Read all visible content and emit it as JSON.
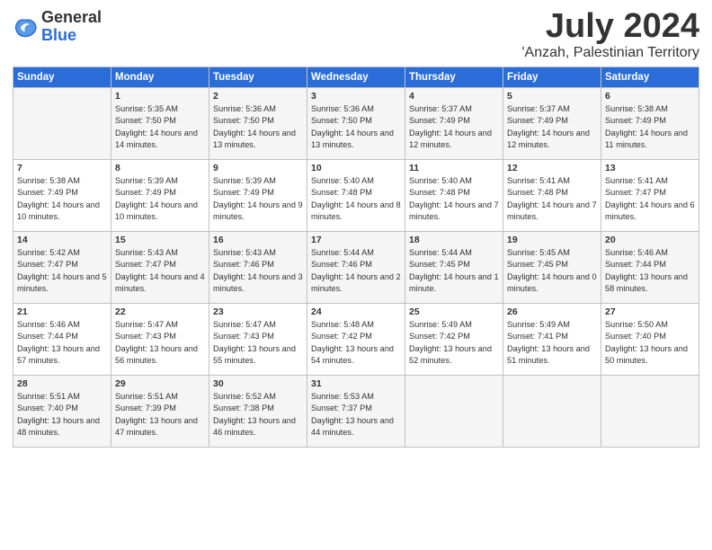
{
  "logo": {
    "general": "General",
    "blue": "Blue"
  },
  "title": "July 2024",
  "location": "'Anzah, Palestinian Territory",
  "headers": [
    "Sunday",
    "Monday",
    "Tuesday",
    "Wednesday",
    "Thursday",
    "Friday",
    "Saturday"
  ],
  "weeks": [
    [
      {
        "day": "",
        "sunrise": "",
        "sunset": "",
        "daylight": ""
      },
      {
        "day": "1",
        "sunrise": "Sunrise: 5:35 AM",
        "sunset": "Sunset: 7:50 PM",
        "daylight": "Daylight: 14 hours and 14 minutes."
      },
      {
        "day": "2",
        "sunrise": "Sunrise: 5:36 AM",
        "sunset": "Sunset: 7:50 PM",
        "daylight": "Daylight: 14 hours and 13 minutes."
      },
      {
        "day": "3",
        "sunrise": "Sunrise: 5:36 AM",
        "sunset": "Sunset: 7:50 PM",
        "daylight": "Daylight: 14 hours and 13 minutes."
      },
      {
        "day": "4",
        "sunrise": "Sunrise: 5:37 AM",
        "sunset": "Sunset: 7:49 PM",
        "daylight": "Daylight: 14 hours and 12 minutes."
      },
      {
        "day": "5",
        "sunrise": "Sunrise: 5:37 AM",
        "sunset": "Sunset: 7:49 PM",
        "daylight": "Daylight: 14 hours and 12 minutes."
      },
      {
        "day": "6",
        "sunrise": "Sunrise: 5:38 AM",
        "sunset": "Sunset: 7:49 PM",
        "daylight": "Daylight: 14 hours and 11 minutes."
      }
    ],
    [
      {
        "day": "7",
        "sunrise": "Sunrise: 5:38 AM",
        "sunset": "Sunset: 7:49 PM",
        "daylight": "Daylight: 14 hours and 10 minutes."
      },
      {
        "day": "8",
        "sunrise": "Sunrise: 5:39 AM",
        "sunset": "Sunset: 7:49 PM",
        "daylight": "Daylight: 14 hours and 10 minutes."
      },
      {
        "day": "9",
        "sunrise": "Sunrise: 5:39 AM",
        "sunset": "Sunset: 7:49 PM",
        "daylight": "Daylight: 14 hours and 9 minutes."
      },
      {
        "day": "10",
        "sunrise": "Sunrise: 5:40 AM",
        "sunset": "Sunset: 7:48 PM",
        "daylight": "Daylight: 14 hours and 8 minutes."
      },
      {
        "day": "11",
        "sunrise": "Sunrise: 5:40 AM",
        "sunset": "Sunset: 7:48 PM",
        "daylight": "Daylight: 14 hours and 7 minutes."
      },
      {
        "day": "12",
        "sunrise": "Sunrise: 5:41 AM",
        "sunset": "Sunset: 7:48 PM",
        "daylight": "Daylight: 14 hours and 7 minutes."
      },
      {
        "day": "13",
        "sunrise": "Sunrise: 5:41 AM",
        "sunset": "Sunset: 7:47 PM",
        "daylight": "Daylight: 14 hours and 6 minutes."
      }
    ],
    [
      {
        "day": "14",
        "sunrise": "Sunrise: 5:42 AM",
        "sunset": "Sunset: 7:47 PM",
        "daylight": "Daylight: 14 hours and 5 minutes."
      },
      {
        "day": "15",
        "sunrise": "Sunrise: 5:43 AM",
        "sunset": "Sunset: 7:47 PM",
        "daylight": "Daylight: 14 hours and 4 minutes."
      },
      {
        "day": "16",
        "sunrise": "Sunrise: 5:43 AM",
        "sunset": "Sunset: 7:46 PM",
        "daylight": "Daylight: 14 hours and 3 minutes."
      },
      {
        "day": "17",
        "sunrise": "Sunrise: 5:44 AM",
        "sunset": "Sunset: 7:46 PM",
        "daylight": "Daylight: 14 hours and 2 minutes."
      },
      {
        "day": "18",
        "sunrise": "Sunrise: 5:44 AM",
        "sunset": "Sunset: 7:45 PM",
        "daylight": "Daylight: 14 hours and 1 minute."
      },
      {
        "day": "19",
        "sunrise": "Sunrise: 5:45 AM",
        "sunset": "Sunset: 7:45 PM",
        "daylight": "Daylight: 14 hours and 0 minutes."
      },
      {
        "day": "20",
        "sunrise": "Sunrise: 5:46 AM",
        "sunset": "Sunset: 7:44 PM",
        "daylight": "Daylight: 13 hours and 58 minutes."
      }
    ],
    [
      {
        "day": "21",
        "sunrise": "Sunrise: 5:46 AM",
        "sunset": "Sunset: 7:44 PM",
        "daylight": "Daylight: 13 hours and 57 minutes."
      },
      {
        "day": "22",
        "sunrise": "Sunrise: 5:47 AM",
        "sunset": "Sunset: 7:43 PM",
        "daylight": "Daylight: 13 hours and 56 minutes."
      },
      {
        "day": "23",
        "sunrise": "Sunrise: 5:47 AM",
        "sunset": "Sunset: 7:43 PM",
        "daylight": "Daylight: 13 hours and 55 minutes."
      },
      {
        "day": "24",
        "sunrise": "Sunrise: 5:48 AM",
        "sunset": "Sunset: 7:42 PM",
        "daylight": "Daylight: 13 hours and 54 minutes."
      },
      {
        "day": "25",
        "sunrise": "Sunrise: 5:49 AM",
        "sunset": "Sunset: 7:42 PM",
        "daylight": "Daylight: 13 hours and 52 minutes."
      },
      {
        "day": "26",
        "sunrise": "Sunrise: 5:49 AM",
        "sunset": "Sunset: 7:41 PM",
        "daylight": "Daylight: 13 hours and 51 minutes."
      },
      {
        "day": "27",
        "sunrise": "Sunrise: 5:50 AM",
        "sunset": "Sunset: 7:40 PM",
        "daylight": "Daylight: 13 hours and 50 minutes."
      }
    ],
    [
      {
        "day": "28",
        "sunrise": "Sunrise: 5:51 AM",
        "sunset": "Sunset: 7:40 PM",
        "daylight": "Daylight: 13 hours and 48 minutes."
      },
      {
        "day": "29",
        "sunrise": "Sunrise: 5:51 AM",
        "sunset": "Sunset: 7:39 PM",
        "daylight": "Daylight: 13 hours and 47 minutes."
      },
      {
        "day": "30",
        "sunrise": "Sunrise: 5:52 AM",
        "sunset": "Sunset: 7:38 PM",
        "daylight": "Daylight: 13 hours and 46 minutes."
      },
      {
        "day": "31",
        "sunrise": "Sunrise: 5:53 AM",
        "sunset": "Sunset: 7:37 PM",
        "daylight": "Daylight: 13 hours and 44 minutes."
      },
      {
        "day": "",
        "sunrise": "",
        "sunset": "",
        "daylight": ""
      },
      {
        "day": "",
        "sunrise": "",
        "sunset": "",
        "daylight": ""
      },
      {
        "day": "",
        "sunrise": "",
        "sunset": "",
        "daylight": ""
      }
    ]
  ]
}
